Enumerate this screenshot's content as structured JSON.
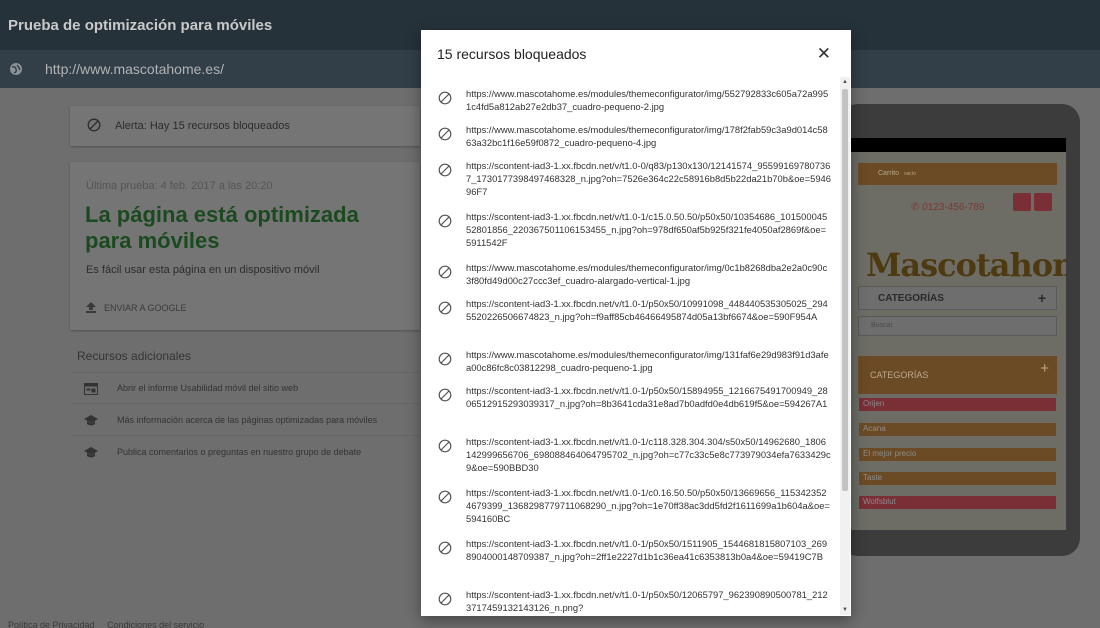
{
  "app": {
    "title": "Prueba de optimización para móviles",
    "url": "http://www.mascotahome.es/"
  },
  "page": {
    "alert": "Alerta: Hay 15 recursos bloqueados",
    "last_test": "Última prueba: 4 feb. 2017 a las 20:20",
    "headline": "La página está optimizada para móviles",
    "subtext": "Es fácil usar esta página en un dispositivo móvil",
    "send_label": "ENVIAR A GOOGLE",
    "resources_title": "Recursos adicionales",
    "resources": [
      {
        "icon": "report-icon",
        "label": "Abrir el informe Usabilidad móvil del sitio web"
      },
      {
        "icon": "school-icon",
        "label": "Más información acerca de las páginas optimizadas para móviles"
      },
      {
        "icon": "school-icon",
        "label": "Publica comentarios o preguntas en nuestro grupo de debate"
      }
    ],
    "footer": {
      "privacy": "Política de Privacidad",
      "terms": "Condiciones del servicio"
    }
  },
  "phone": {
    "cart": "Carrito",
    "cart_state": "vacío",
    "phone_number": "0123-456-789",
    "logo": "Mascotahome",
    "categories_label": "CATEGORÍAS",
    "search_placeholder": "Buscar",
    "categories_block": "CATEGORÍAS",
    "category_items": [
      "Orijen",
      "Acana",
      "El mejor precio",
      "Taste",
      "Wolfsblut"
    ]
  },
  "dialog": {
    "title": "15 recursos bloqueados",
    "close_icon": "close-icon",
    "blocked_icon": "block-icon",
    "items": [
      "https://www.mascotahome.es/modules/themeconfigurator/img/552792833c605a72a9951c4fd5a812ab27e2db37_cuadro-pequeno-2.jpg",
      "https://www.mascotahome.es/modules/themeconfigurator/img/178f2fab59c3a9d014c5863a32bc1f16e59f0872_cuadro-pequeno-4.jpg",
      "https://scontent-iad3-1.xx.fbcdn.net/v/t1.0-0/q83/p130x130/12141574_955991697807367_1730177398497468328_n.jpg?oh=7526e364c22c58916b8d5b22da21b70b&oe=594696F7",
      "https://scontent-iad3-1.xx.fbcdn.net/v/t1.0-1/c15.0.50.50/p50x50/10354686_10150004552801856_220367501106153455_n.jpg?oh=978df650af5b925f321fe4050af2869f&oe=5911542F",
      "https://www.mascotahome.es/modules/themeconfigurator/img/0c1b8268dba2e2a0c90c3f80fd49d00c27ccc3ef_cuadro-alargado-vertical-1.jpg",
      "https://scontent-iad3-1.xx.fbcdn.net/v/t1.0-1/p50x50/10991098_448440535305025_2945520226506674823_n.jpg?oh=f9aff85cb46466495874d05a13bf6674&oe=590F954A",
      "https://www.mascotahome.es/modules/themeconfigurator/img/131faf6e29d983f91d3afea00c86fc8c03812298_cuadro-pequeno-1.jpg",
      "https://scontent-iad3-1.xx.fbcdn.net/v/t1.0-1/p50x50/15894955_1216675491700949_2806512915293039317_n.jpg?oh=8b3641cda31e8ad7b0adfd0e4db619f5&oe=594267A1",
      "https://scontent-iad3-1.xx.fbcdn.net/v/t1.0-1/c118.328.304.304/s50x50/14962680_1806142999656706_698088464064795702_n.jpg?oh=c77c33c5e8c773979034efa7633429c9&oe=590BBD30",
      "https://scontent-iad3-1.xx.fbcdn.net/v/t1.0-1/c0.16.50.50/p50x50/13669656_1153423524679399_1368298779711068290_n.jpg?oh=1e70ff38ac3dd5fd2f1611699a1b604a&oe=594160BC",
      "https://scontent-iad3-1.xx.fbcdn.net/v/t1.0-1/p50x50/1511905_1544681815807103_2698904000148709387_n.jpg?oh=2ff1e2227d1b1c36ea41c6353813b0a4&oe=59419C7B",
      "https://scontent-iad3-1.xx.fbcdn.net/v/t1.0-1/p50x50/12065797_962390890500781_2123717459132143126_n.png?"
    ]
  }
}
